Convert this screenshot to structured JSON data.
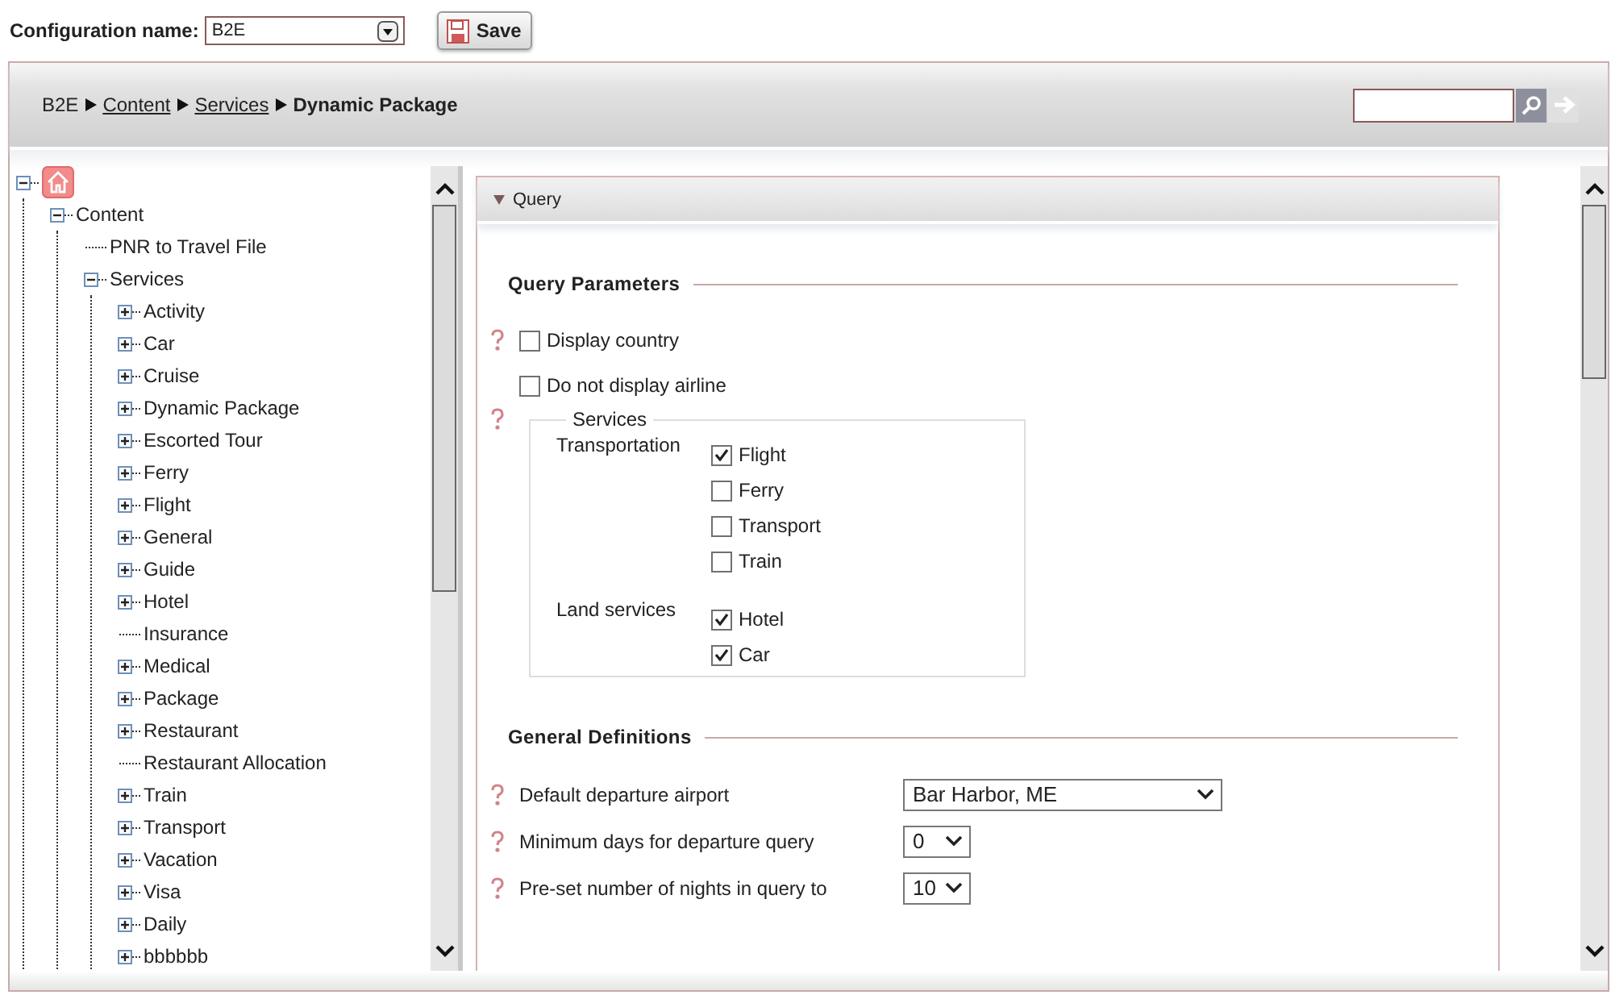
{
  "config": {
    "label": "Configuration name:",
    "value": "B2E"
  },
  "save_button": {
    "label": "Save"
  },
  "breadcrumb": [
    {
      "label": "B2E",
      "kind": "plain"
    },
    {
      "label": "Content",
      "kind": "link"
    },
    {
      "label": "Services",
      "kind": "link"
    },
    {
      "label": "Dynamic Package",
      "kind": "current"
    }
  ],
  "tree": {
    "kind": "home",
    "expanded": true,
    "children": [
      {
        "label": "Content",
        "kind": "folder",
        "expanded": true,
        "children": [
          {
            "label": "PNR to Travel File",
            "kind": "leaf"
          },
          {
            "label": "Services",
            "kind": "folder",
            "expanded": true,
            "children": [
              {
                "label": "Activity",
                "kind": "folder",
                "expanded": false
              },
              {
                "label": "Car",
                "kind": "folder",
                "expanded": false
              },
              {
                "label": "Cruise",
                "kind": "folder",
                "expanded": false
              },
              {
                "label": "Dynamic Package",
                "kind": "folder",
                "expanded": false
              },
              {
                "label": "Escorted Tour",
                "kind": "folder",
                "expanded": false
              },
              {
                "label": "Ferry",
                "kind": "folder",
                "expanded": false
              },
              {
                "label": "Flight",
                "kind": "folder",
                "expanded": false
              },
              {
                "label": "General",
                "kind": "folder",
                "expanded": false
              },
              {
                "label": "Guide",
                "kind": "folder",
                "expanded": false
              },
              {
                "label": "Hotel",
                "kind": "folder",
                "expanded": false
              },
              {
                "label": "Insurance",
                "kind": "leaf"
              },
              {
                "label": "Medical",
                "kind": "folder",
                "expanded": false
              },
              {
                "label": "Package",
                "kind": "folder",
                "expanded": false
              },
              {
                "label": "Restaurant",
                "kind": "folder",
                "expanded": false
              },
              {
                "label": "Restaurant Allocation",
                "kind": "leaf"
              },
              {
                "label": "Train",
                "kind": "folder",
                "expanded": false
              },
              {
                "label": "Transport",
                "kind": "folder",
                "expanded": false
              },
              {
                "label": "Vacation",
                "kind": "folder",
                "expanded": false
              },
              {
                "label": "Visa",
                "kind": "folder",
                "expanded": false
              },
              {
                "label": "Daily",
                "kind": "folder",
                "expanded": false
              },
              {
                "label": "bbbbbb",
                "kind": "folder",
                "expanded": false
              }
            ]
          }
        ]
      }
    ]
  },
  "panel": {
    "title": "Query",
    "expanded": true,
    "sections": [
      {
        "title": "Query Parameters",
        "items": [
          {
            "kind": "checkbox",
            "label": "Display country",
            "help": true,
            "checked": false
          },
          {
            "kind": "checkbox",
            "label": "Do not display airline",
            "help": false,
            "checked": false
          },
          {
            "kind": "group",
            "legend": "Services",
            "help": true,
            "groups": [
              {
                "label": "Transportation",
                "options": [
                  {
                    "label": "Flight",
                    "checked": true
                  },
                  {
                    "label": "Ferry",
                    "checked": false
                  },
                  {
                    "label": "Transport",
                    "checked": false
                  },
                  {
                    "label": "Train",
                    "checked": false
                  }
                ]
              },
              {
                "label": "Land services",
                "options": [
                  {
                    "label": "Hotel",
                    "checked": true
                  },
                  {
                    "label": "Car",
                    "checked": true
                  }
                ]
              }
            ]
          }
        ]
      },
      {
        "title": "General Definitions",
        "items": [
          {
            "kind": "select",
            "label": "Default departure airport",
            "help": true,
            "value": "Bar Harbor, ME"
          },
          {
            "kind": "number-select",
            "label": "Minimum days for departure query",
            "help": true,
            "value": "0"
          },
          {
            "kind": "number-select",
            "label": "Pre-set number of nights in query to",
            "help": true,
            "value": "10"
          }
        ]
      }
    ]
  }
}
